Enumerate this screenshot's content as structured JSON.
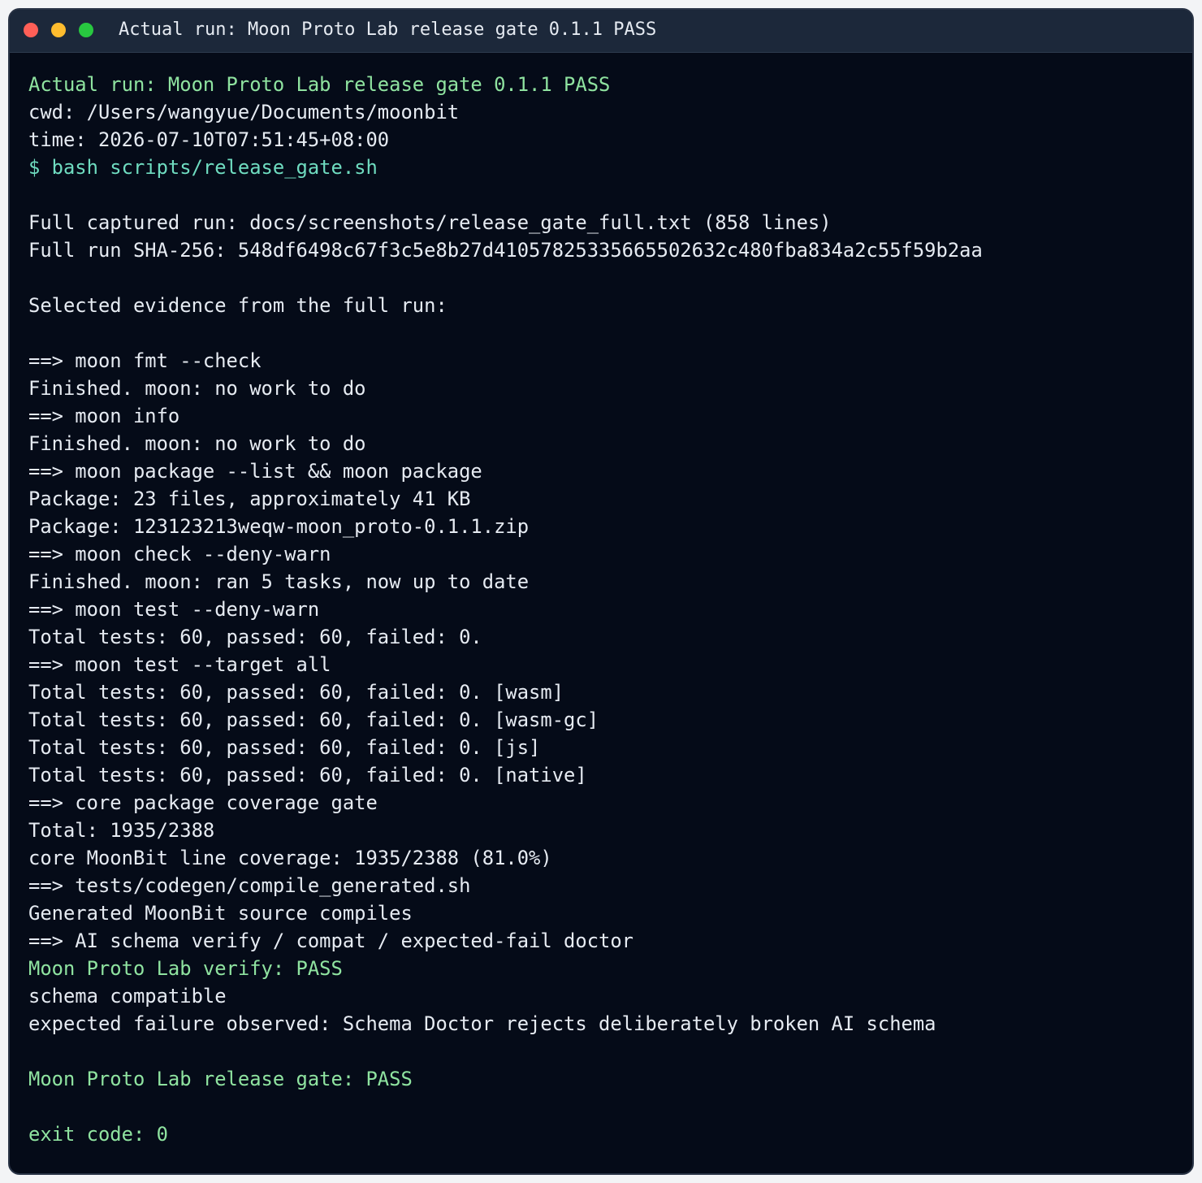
{
  "window": {
    "title": "Actual run: Moon Proto Lab release gate 0.1.1 PASS",
    "controls": [
      {
        "name": "close-button",
        "color": "#ff5f57"
      },
      {
        "name": "minimize-button",
        "color": "#febc2e"
      },
      {
        "name": "zoom-button",
        "color": "#28c840"
      }
    ]
  },
  "colors": {
    "background": "#050b18",
    "titlebar": "#1c283a",
    "text": "#e6ebf2",
    "pass": "#8fe3a0",
    "command": "#6fdcc0"
  },
  "terminal": {
    "lines": [
      {
        "text": "Actual run: Moon Proto Lab release gate 0.1.1 PASS",
        "style": "ok"
      },
      {
        "text": "cwd: /Users/wangyue/Documents/moonbit",
        "style": "normal"
      },
      {
        "text": "time: 2026-07-10T07:51:45+08:00",
        "style": "normal"
      },
      {
        "text": "$ bash scripts/release_gate.sh",
        "style": "cmd"
      },
      {
        "text": "",
        "style": "blank"
      },
      {
        "text": "Full captured run: docs/screenshots/release_gate_full.txt (858 lines)",
        "style": "normal"
      },
      {
        "text": "Full run SHA-256: 548df6498c67f3c5e8b27d410578253356655026 32c480fba834a2c55f59b2aa",
        "style": "normal"
      },
      {
        "text": "",
        "style": "blank"
      },
      {
        "text": "Selected evidence from the full run:",
        "style": "normal"
      },
      {
        "text": "",
        "style": "blank"
      },
      {
        "text": "==> moon fmt --check",
        "style": "normal"
      },
      {
        "text": "Finished. moon: no work to do",
        "style": "normal"
      },
      {
        "text": "==> moon info",
        "style": "normal"
      },
      {
        "text": "Finished. moon: no work to do",
        "style": "normal"
      },
      {
        "text": "==> moon package --list && moon package",
        "style": "normal"
      },
      {
        "text": "Package: 23 files, approximately 41 KB",
        "style": "normal"
      },
      {
        "text": "Package: 123123213weqw-moon_proto-0.1.1.zip",
        "style": "normal"
      },
      {
        "text": "==> moon check --deny-warn",
        "style": "normal"
      },
      {
        "text": "Finished. moon: ran 5 tasks, now up to date",
        "style": "normal"
      },
      {
        "text": "==> moon test --deny-warn",
        "style": "normal"
      },
      {
        "text": "Total tests: 60, passed: 60, failed: 0.",
        "style": "normal"
      },
      {
        "text": "==> moon test --target all",
        "style": "normal"
      },
      {
        "text": "Total tests: 60, passed: 60, failed: 0. [wasm]",
        "style": "normal"
      },
      {
        "text": "Total tests: 60, passed: 60, failed: 0. [wasm-gc]",
        "style": "normal"
      },
      {
        "text": "Total tests: 60, passed: 60, failed: 0. [js]",
        "style": "normal"
      },
      {
        "text": "Total tests: 60, passed: 60, failed: 0. [native]",
        "style": "normal"
      },
      {
        "text": "==> core package coverage gate",
        "style": "normal"
      },
      {
        "text": "Total: 1935/2388",
        "style": "normal"
      },
      {
        "text": "core MoonBit line coverage: 1935/2388 (81.0%)",
        "style": "normal"
      },
      {
        "text": "==> tests/codegen/compile_generated.sh",
        "style": "normal"
      },
      {
        "text": "Generated MoonBit source compiles",
        "style": "normal"
      },
      {
        "text": "==> AI schema verify / compat / expected-fail doctor",
        "style": "normal"
      },
      {
        "text": "Moon Proto Lab verify: PASS",
        "style": "ok"
      },
      {
        "text": "schema compatible",
        "style": "normal"
      },
      {
        "text": "expected failure observed: Schema Doctor rejects deliberately broken AI schema",
        "style": "normal"
      },
      {
        "text": "",
        "style": "blank"
      },
      {
        "text": "Moon Proto Lab release gate: PASS",
        "style": "ok"
      },
      {
        "text": "",
        "style": "blank"
      },
      {
        "text": "exit code: 0",
        "style": "ok"
      }
    ]
  }
}
